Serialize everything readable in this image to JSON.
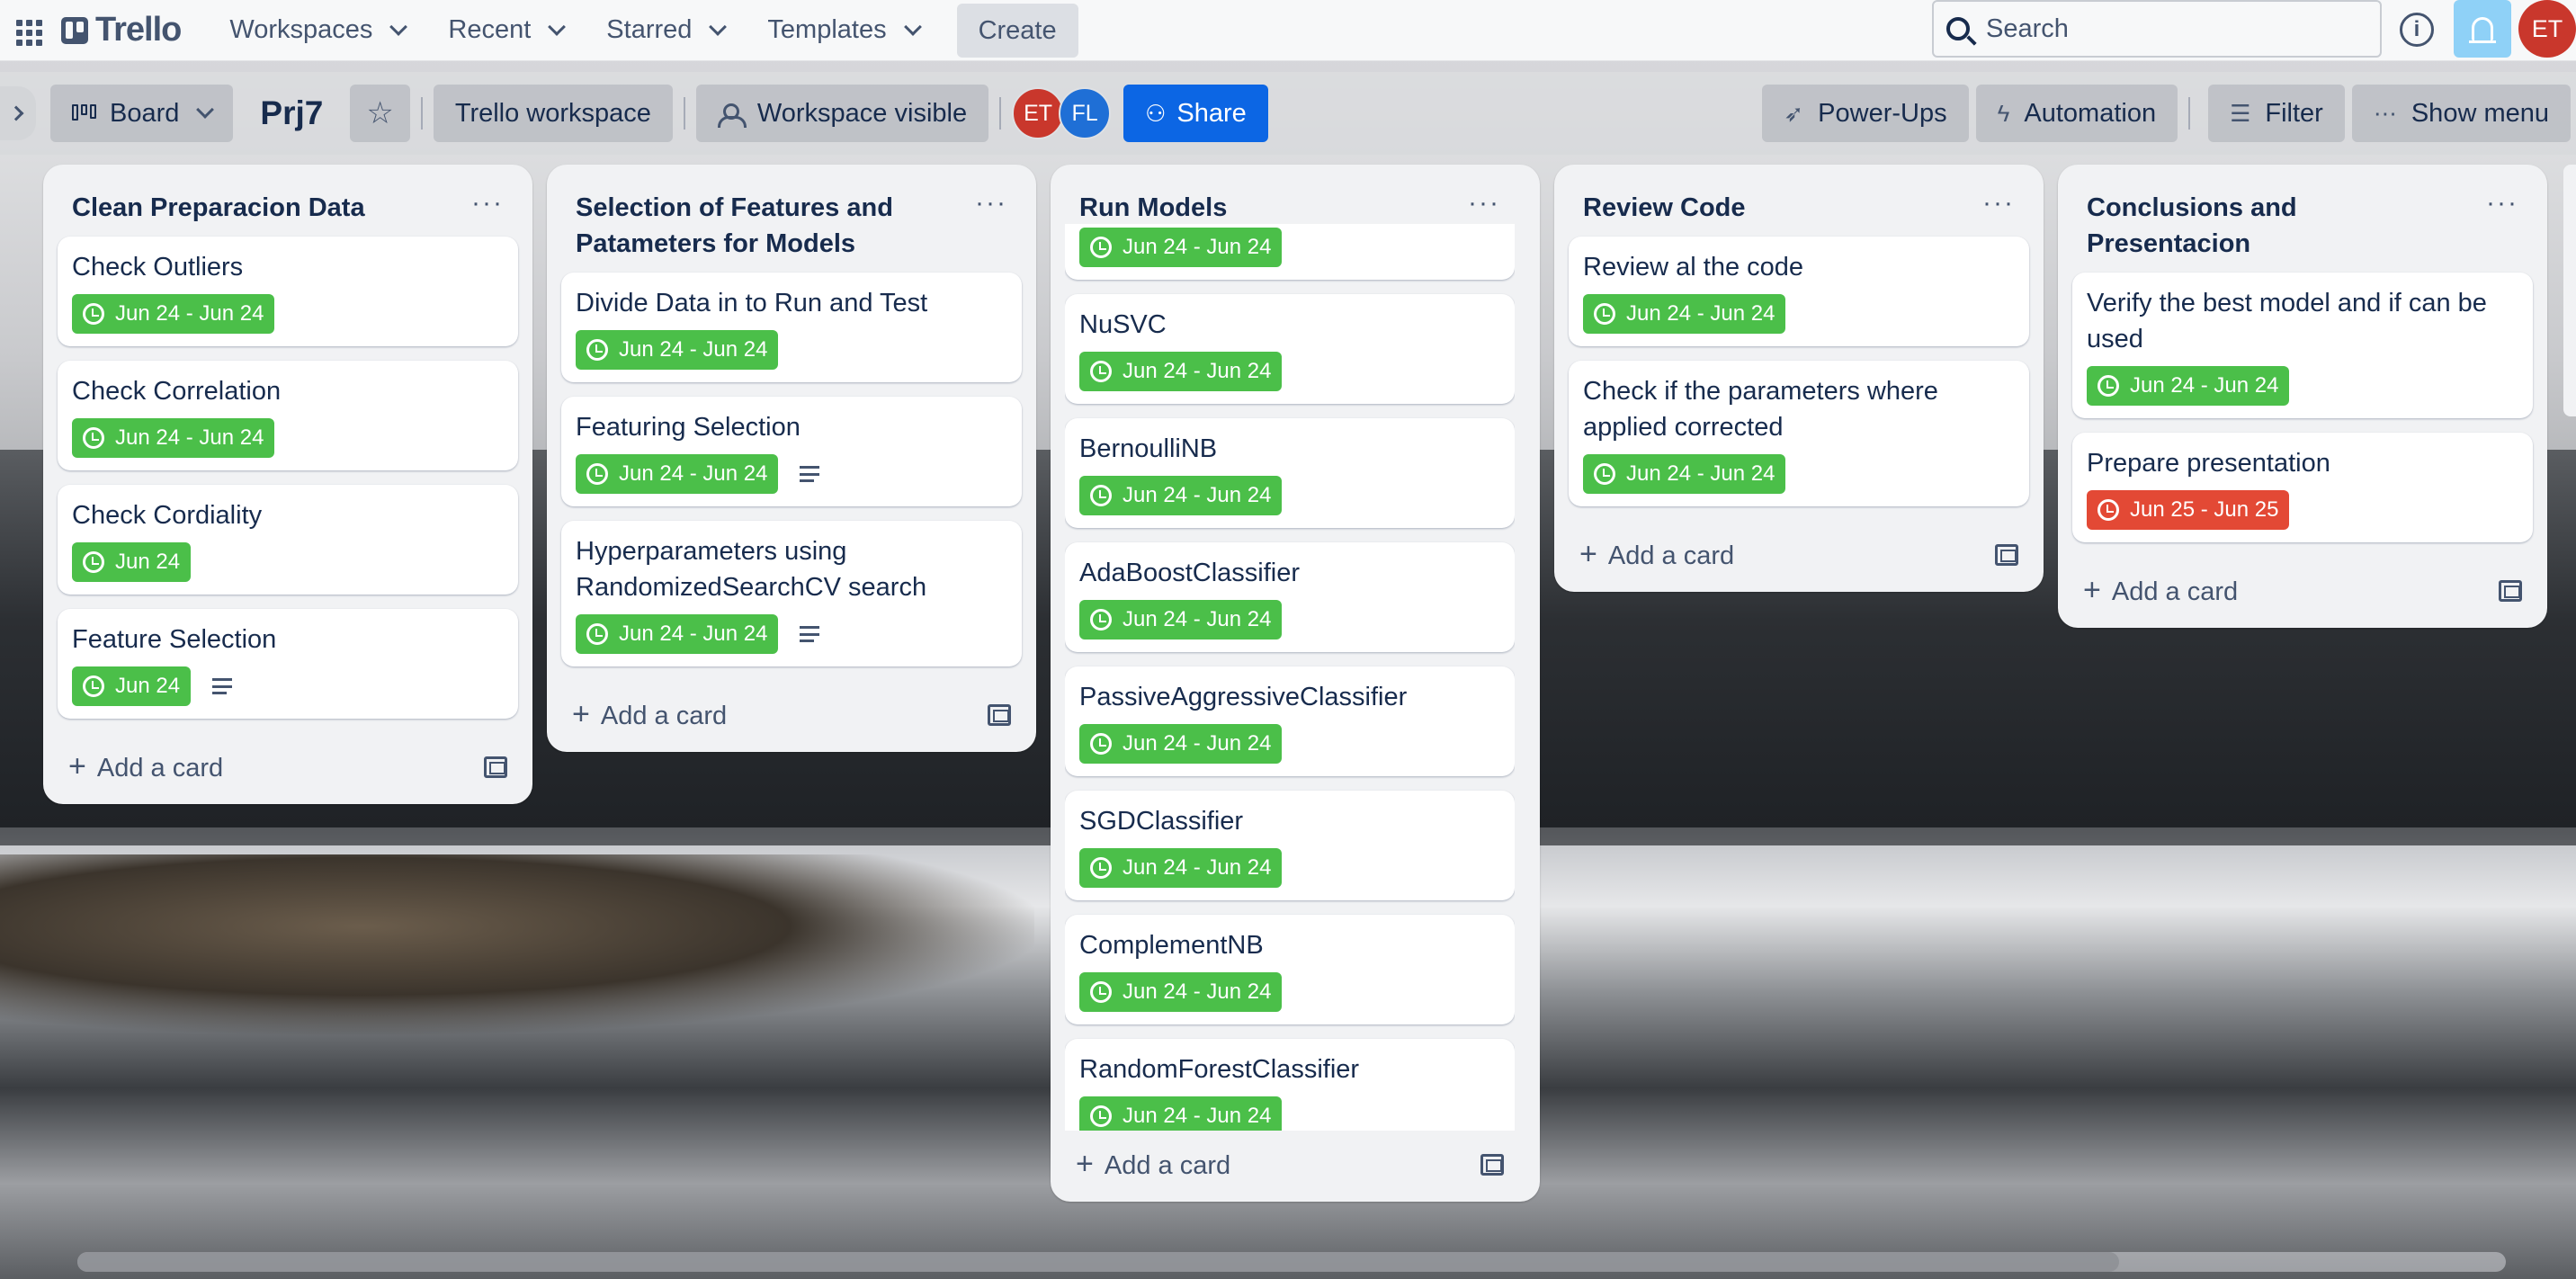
{
  "topbar": {
    "logo_text": "Trello",
    "menus": [
      "Workspaces",
      "Recent",
      "Starred",
      "Templates"
    ],
    "create_label": "Create",
    "search_placeholder": "Search",
    "info_label": "i",
    "user_initials": "ET"
  },
  "board": {
    "view_label": "Board",
    "title": "Prj7",
    "workspace_label": "Trello workspace",
    "visibility_label": "Workspace visible",
    "members": [
      {
        "initials": "ET",
        "color": "#c9372c"
      },
      {
        "initials": "FL",
        "color": "#1f6fd6"
      }
    ],
    "share_label": "Share",
    "powerups_label": "Power-Ups",
    "automation_label": "Automation",
    "filter_label": "Filter",
    "menu_label": "Show menu"
  },
  "lists": [
    {
      "title": "Clean Preparacion Data",
      "cards": [
        {
          "title": "Check Outliers",
          "date": "Jun 24 - Jun 24"
        },
        {
          "title": "Check Correlation",
          "date": "Jun 24 - Jun 24"
        },
        {
          "title": "Check Cordiality",
          "date": "Jun 24"
        },
        {
          "title": "Feature Selection",
          "date": "Jun 24",
          "has_description": true
        }
      ],
      "add_label": "Add a card"
    },
    {
      "title": "Selection of Features and Patameters for Models",
      "cards": [
        {
          "title": "Divide Data in to Run and Test",
          "date": "Jun 24 - Jun 24"
        },
        {
          "title": "Featuring Selection",
          "date": "Jun 24 - Jun 24",
          "has_description": true
        },
        {
          "title": "Hyperparameters using RandomizedSearchCV search",
          "date": "Jun 24 - Jun 24",
          "has_description": true
        }
      ],
      "add_label": "Add a card"
    },
    {
      "title": "Run Models",
      "cards": [
        {
          "title": "",
          "date": "Jun 24 - Jun 24"
        },
        {
          "title": "NuSVC",
          "date": "Jun 24 - Jun 24"
        },
        {
          "title": "BernoulliNB",
          "date": "Jun 24 - Jun 24"
        },
        {
          "title": "AdaBoostClassifier",
          "date": "Jun 24 - Jun 24"
        },
        {
          "title": "PassiveAggressiveClassifier",
          "date": "Jun 24 - Jun 24"
        },
        {
          "title": "SGDClassifier",
          "date": "Jun 24 - Jun 24"
        },
        {
          "title": "ComplementNB",
          "date": "Jun 24 - Jun 24"
        },
        {
          "title": "RandomForestClassifier",
          "date": "Jun 24 - Jun 24"
        }
      ],
      "add_label": "Add a card"
    },
    {
      "title": "Review Code",
      "cards": [
        {
          "title": "Review al the code",
          "date": "Jun 24 - Jun 24"
        },
        {
          "title": "Check if the parameters where applied corrected",
          "date": "Jun 24 - Jun 24"
        }
      ],
      "add_label": "Add a card"
    },
    {
      "title": "Conclusions and Presentacion",
      "cards": [
        {
          "title": "Verify the best model and if can be used",
          "date": "Jun 24 - Jun 24"
        },
        {
          "title": "Prepare presentation",
          "date": "Jun 25 - Jun 25",
          "overdue": true
        }
      ],
      "add_label": "Add a card"
    }
  ],
  "colors": {
    "date_badge": "#4bbf49",
    "overdue_badge": "#e34935",
    "share_button": "#0c66e4",
    "notification_button": "#8fd1f7"
  }
}
